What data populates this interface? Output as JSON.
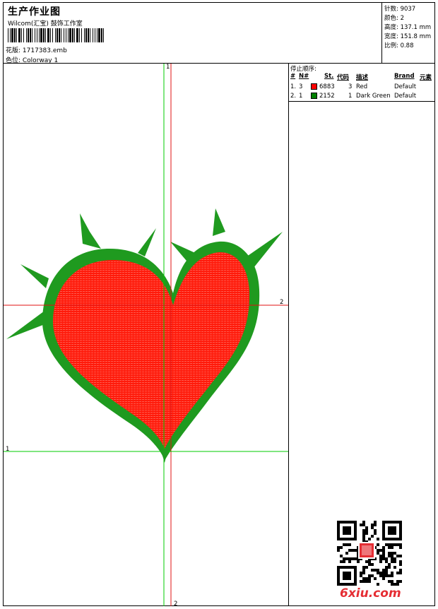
{
  "header": {
    "title": "生产作业图",
    "company": "Wilcom(汇宝) 鼓饰工作室",
    "design_file": "花版: 1717383.emb",
    "colorway": "色位: Colorway 1"
  },
  "stats": {
    "stitches": "针数: 9037",
    "colors": "颜色: 2",
    "height": "高度: 137.1 mm",
    "width": "宽度: 151.8 mm",
    "scale": "比例: 0.88"
  },
  "stop_sequence": {
    "title": "停止顺序:",
    "headers": [
      "#",
      "N#",
      "St.",
      "代码",
      "描述",
      "Brand",
      "元素"
    ],
    "rows": [
      {
        "index": "1.",
        "needle": "3",
        "color": "#ff0000",
        "stitches": "6883",
        "code": "3",
        "description": "Red",
        "brand": "Default"
      },
      {
        "index": "2.",
        "needle": "1",
        "color": "#008000",
        "stitches": "2152",
        "code": "1",
        "description": "Dark Green",
        "brand": "Default"
      }
    ]
  },
  "axis_labels": {
    "v1_top": "1",
    "v2_bottom": "2",
    "h1_left": "1",
    "h2_right": "2"
  },
  "colors": {
    "red_fill": "#ff1a0a",
    "green_outline": "#1f9a1f",
    "guide_green": "#00cc00",
    "guide_red": "#e01010"
  },
  "watermark": "6xiu.com"
}
